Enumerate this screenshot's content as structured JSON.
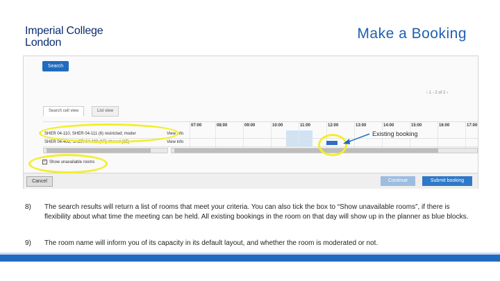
{
  "logo": {
    "line1": "Imperial College",
    "line2": "London"
  },
  "slide_title": "Make a Booking",
  "screenshot": {
    "search_label": "Search",
    "pager": "1 - 2 of 2",
    "tabs": [
      "Search cell view",
      "List view"
    ],
    "hours": [
      "07:00",
      "08:00",
      "09:00",
      "10:00",
      "11:00",
      "12:00",
      "13:00",
      "14:00",
      "15:00",
      "16:00",
      "17:00"
    ],
    "rooms": [
      {
        "name": "SHER 04-110, SHER 04-111 (6) restricted; moder",
        "info": "View info"
      },
      {
        "name": "SHER 04-402, SHER 04-403 (15) shared (15)",
        "info": "View info"
      }
    ],
    "show_unavailable": "Show unavailable rooms",
    "cancel_label": "Cancel",
    "continue_label": "Continue",
    "submit_label": "Submit booking"
  },
  "annotation": {
    "existing_booking": "Existing booking"
  },
  "items": [
    {
      "num": "8)",
      "text": "The search results will return a list of rooms that meet your criteria. You can also tick the box to “Show unavailable rooms”, if there is flexibility about what time the meeting can be held. All existing bookings in the room on that day will show up in the planner as blue blocks."
    },
    {
      "num": "9)",
      "text": "The room name will inform you of its capacity in its default layout, and whether the room is moderated or not."
    }
  ],
  "colors": {
    "brand": "#0a2a6e",
    "title": "#1f5fb0",
    "highlight": "#f3ee2a",
    "booking": "#2f6fc0"
  }
}
